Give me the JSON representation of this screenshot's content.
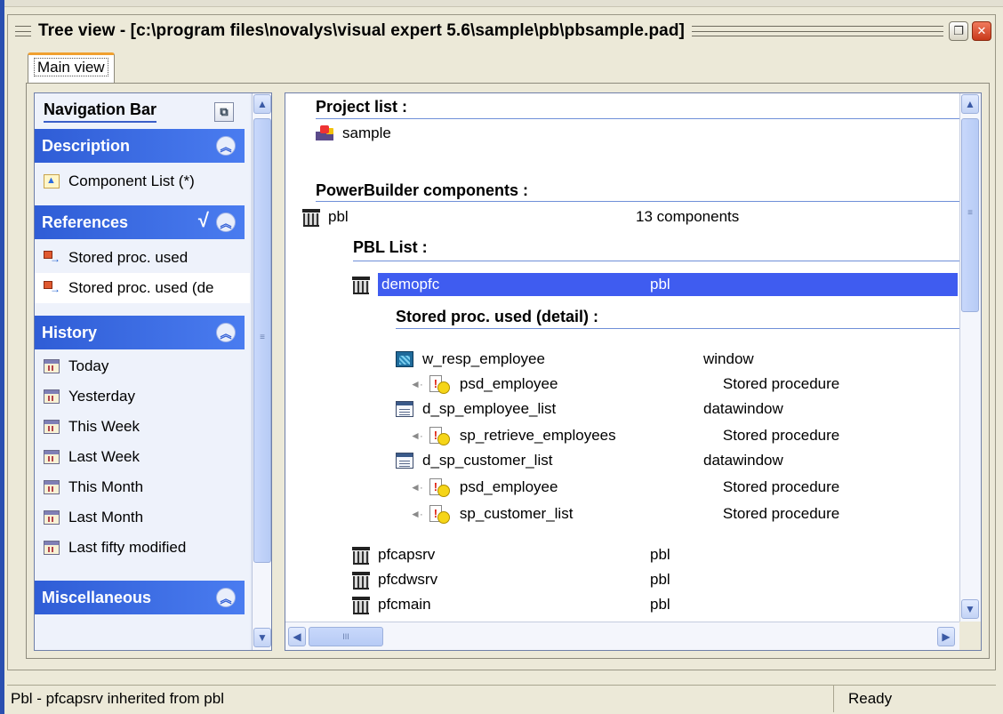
{
  "window": {
    "title": "Tree view - [c:\\program files\\novalys\\visual expert 5.6\\sample\\pb\\pbsample.pad]",
    "restore_glyph": "❐",
    "close_glyph": "✕"
  },
  "tabs": [
    {
      "label": "Main view"
    }
  ],
  "navbar": {
    "title": "Navigation Bar",
    "pin_glyph": "⧉",
    "collapse_glyph": "︽",
    "sections": {
      "description": {
        "label": "Description",
        "items": [
          {
            "label": "Component List (*)",
            "icon": "component-list-icon"
          }
        ]
      },
      "references": {
        "label": "References",
        "check": "√",
        "items": [
          {
            "label": "Stored proc. used",
            "icon": "stored-proc-icon"
          },
          {
            "label": "Stored proc. used (de",
            "icon": "stored-proc-icon"
          }
        ]
      },
      "history": {
        "label": "History",
        "items": [
          {
            "label": "Today",
            "icon": "calendar-icon"
          },
          {
            "label": "Yesterday",
            "icon": "calendar-icon"
          },
          {
            "label": "This Week",
            "icon": "calendar-icon"
          },
          {
            "label": "Last Week",
            "icon": "calendar-icon"
          },
          {
            "label": "This Month",
            "icon": "calendar-icon"
          },
          {
            "label": "Last Month",
            "icon": "calendar-icon"
          },
          {
            "label": "Last fifty modified",
            "icon": "calendar-icon"
          }
        ]
      },
      "misc": {
        "label": "Miscellaneous"
      }
    }
  },
  "tree": {
    "project_header": "Project list :",
    "project": {
      "name": "sample"
    },
    "components_header": "PowerBuilder components :",
    "pbl": {
      "name": "pbl",
      "info": "13 components"
    },
    "pbl_list_header": "PBL List :",
    "selected": {
      "name": "demopfc",
      "type": "pbl"
    },
    "detail_header": "Stored proc. used (detail) :",
    "detail": [
      {
        "name": "w_resp_employee",
        "type": "window",
        "kind": "window"
      },
      {
        "name": "psd_employee",
        "type": "Stored procedure",
        "kind": "proc"
      },
      {
        "name": "d_sp_employee_list",
        "type": "datawindow",
        "kind": "dw"
      },
      {
        "name": "sp_retrieve_employees",
        "type": "Stored procedure",
        "kind": "proc"
      },
      {
        "name": "d_sp_customer_list",
        "type": "datawindow",
        "kind": "dw"
      },
      {
        "name": "psd_employee",
        "type": "Stored procedure",
        "kind": "proc"
      },
      {
        "name": "sp_customer_list",
        "type": "Stored procedure",
        "kind": "proc"
      }
    ],
    "libraries": [
      {
        "name": "pfcapsrv",
        "type": "pbl"
      },
      {
        "name": "pfcdwsrv",
        "type": "pbl"
      },
      {
        "name": "pfcmain",
        "type": "pbl"
      }
    ]
  },
  "scroll": {
    "up": "▲",
    "down": "▼",
    "left": "◀",
    "right": "▶",
    "grip_v": "≡",
    "grip_h": "III"
  },
  "status": {
    "left": "Pbl - pfcapsrv inherited from pbl",
    "right": "Ready"
  }
}
